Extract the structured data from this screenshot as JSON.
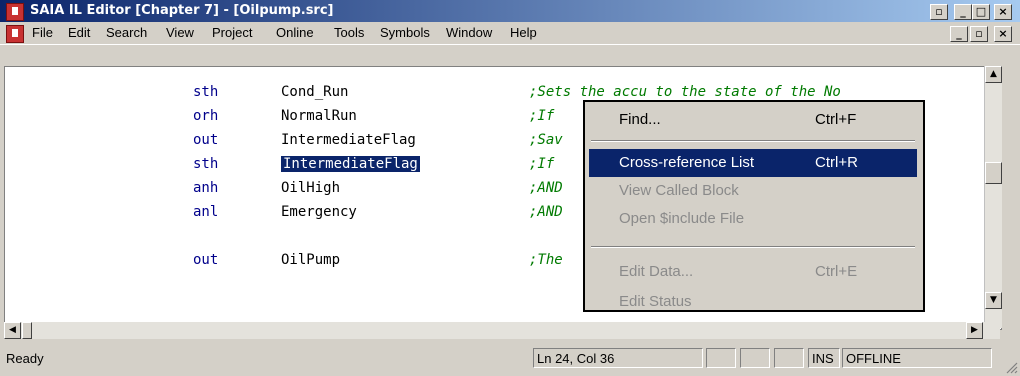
{
  "window": {
    "title": "SAIA IL Editor [Chapter 7] - [Oilpump.src]",
    "app_icon": "saia-app-icon",
    "outer_controls": [
      "restore-icon",
      "minimize-icon",
      "maximize-icon",
      "close-icon"
    ],
    "inner_controls": [
      "minimize-icon",
      "restore-icon",
      "close-icon"
    ]
  },
  "menu": [
    "File",
    "Edit",
    "Search",
    "View",
    "Project",
    "Online",
    "Tools",
    "Symbols",
    "Window",
    "Help"
  ],
  "code": [
    {
      "op": "sth",
      "arg": "Cond_Run",
      "comment": ";Sets the accu to the state of the No"
    },
    {
      "op": "orh",
      "arg": "NormalRun",
      "comment": ";If"
    },
    {
      "op": "out",
      "arg": "IntermediateFlag",
      "comment": ";Sav"
    },
    {
      "op": "sth",
      "arg": "IntermediateFlag",
      "comment": ";If",
      "selected": true
    },
    {
      "op": "anh",
      "arg": "OilHigh",
      "comment": ";AND"
    },
    {
      "op": "anl",
      "arg": "Emergency",
      "comment": ";AND"
    },
    {
      "op": "",
      "arg": "",
      "comment": ""
    },
    {
      "op": "out",
      "arg": "OilPump",
      "comment": ";The"
    }
  ],
  "context_menu": [
    {
      "label": "Find...",
      "shortcut": "Ctrl+F",
      "state": "normal"
    },
    {
      "separator": true
    },
    {
      "label": "Cross-reference List",
      "shortcut": "Ctrl+R",
      "state": "highlighted"
    },
    {
      "label": "View Called Block",
      "shortcut": "",
      "state": "disabled"
    },
    {
      "label": "Open $include File",
      "shortcut": "",
      "state": "disabled"
    },
    {
      "separator": true
    },
    {
      "label": "Edit Data...",
      "shortcut": "Ctrl+E",
      "state": "disabled"
    },
    {
      "label": "Edit Status",
      "shortcut": "",
      "state": "disabled"
    }
  ],
  "status": {
    "ready": "Ready",
    "position": "Ln 24, Col 36",
    "ins": "INS",
    "mode": "OFFLINE"
  },
  "colors": {
    "titlebar": "#0a246a",
    "selection": "#0a246a",
    "opcode": "#00008b",
    "comment": "#007a00",
    "chrome": "#d4d0c8"
  }
}
